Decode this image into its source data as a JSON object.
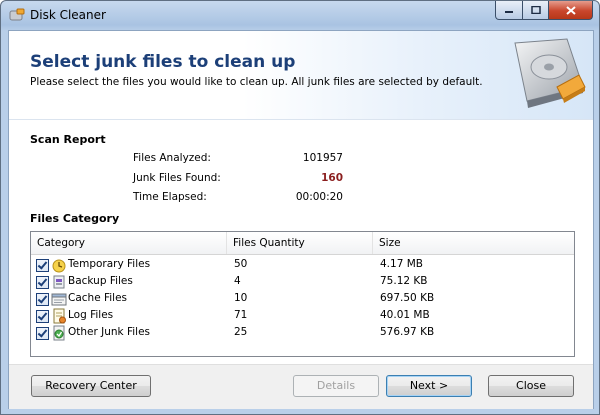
{
  "window": {
    "title": "Disk Cleaner",
    "controls": [
      "minimize",
      "maximize",
      "close"
    ]
  },
  "header": {
    "title": "Select junk files to clean up",
    "subtitle": "Please select the files you would like to clean up. All junk files are selected by default."
  },
  "scan_report": {
    "title": "Scan Report",
    "rows": [
      {
        "label": "Files Analyzed:",
        "value": "101957"
      },
      {
        "label": "Junk Files Found:",
        "value": "160"
      },
      {
        "label": "Time Elapsed:",
        "value": "00:00:20"
      }
    ]
  },
  "files_category": {
    "title": "Files Category",
    "columns": [
      "Category",
      "Files Quantity",
      "Size"
    ],
    "rows": [
      {
        "category": "Temporary Files",
        "quantity": "50",
        "size": "4.17 MB",
        "checked": true,
        "icon": "temporary-files-icon"
      },
      {
        "category": "Backup Files",
        "quantity": "4",
        "size": "75.12 KB",
        "checked": true,
        "icon": "backup-files-icon"
      },
      {
        "category": "Cache Files",
        "quantity": "10",
        "size": "697.50 KB",
        "checked": true,
        "icon": "cache-files-icon"
      },
      {
        "category": "Log Files",
        "quantity": "71",
        "size": "40.01 MB",
        "checked": true,
        "icon": "log-files-icon"
      },
      {
        "category": "Other Junk Files",
        "quantity": "25",
        "size": "576.97 KB",
        "checked": true,
        "icon": "other-junk-files-icon"
      }
    ]
  },
  "footer": {
    "recovery_center": "Recovery Center",
    "details": "Details",
    "next": "Next >",
    "close": "Close"
  },
  "colors": {
    "header_title": "#1c3f78",
    "junk_count": "#8b1f1f"
  }
}
